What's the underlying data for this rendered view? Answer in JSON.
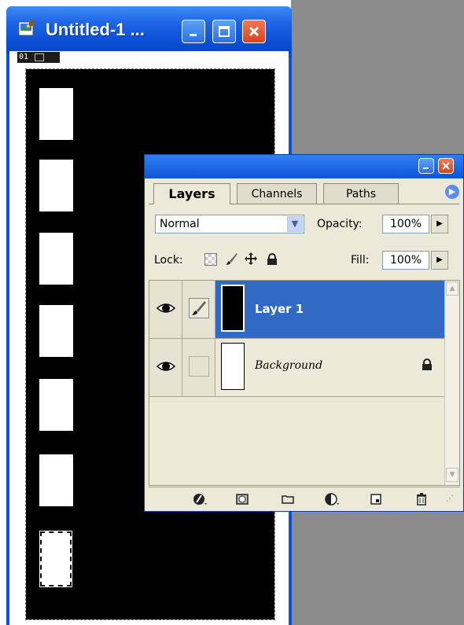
{
  "document_window": {
    "title": "Untitled-1 ...",
    "status_page": "01",
    "icons": {
      "app": "photoshop-doc-icon",
      "minimize": "minimize-icon",
      "maximize": "maximize-icon",
      "close": "close-icon",
      "page_preview": "image-preview-icon"
    }
  },
  "layers_palette": {
    "tabs": [
      "Layers",
      "Channels",
      "Paths"
    ],
    "active_tab": "Layers",
    "blend_mode": "Normal",
    "opacity_label": "Opacity:",
    "opacity_value": "100%",
    "lock_label": "Lock:",
    "fill_label": "Fill:",
    "fill_value": "100%",
    "layers": [
      {
        "name": "Layer 1",
        "selected": true,
        "visible": true,
        "linked_brush": true
      },
      {
        "name": "Background",
        "selected": false,
        "visible": true,
        "locked": true
      }
    ],
    "toolbar_icons": [
      "layer-style-icon",
      "add-mask-icon",
      "new-group-icon",
      "new-fill-adjustment-icon",
      "new-layer-icon",
      "delete-layer-icon"
    ],
    "colors": {
      "title_bar": "#0e55d8",
      "selected_row": "#316ac5",
      "panel_bg": "#ece9d8"
    }
  }
}
